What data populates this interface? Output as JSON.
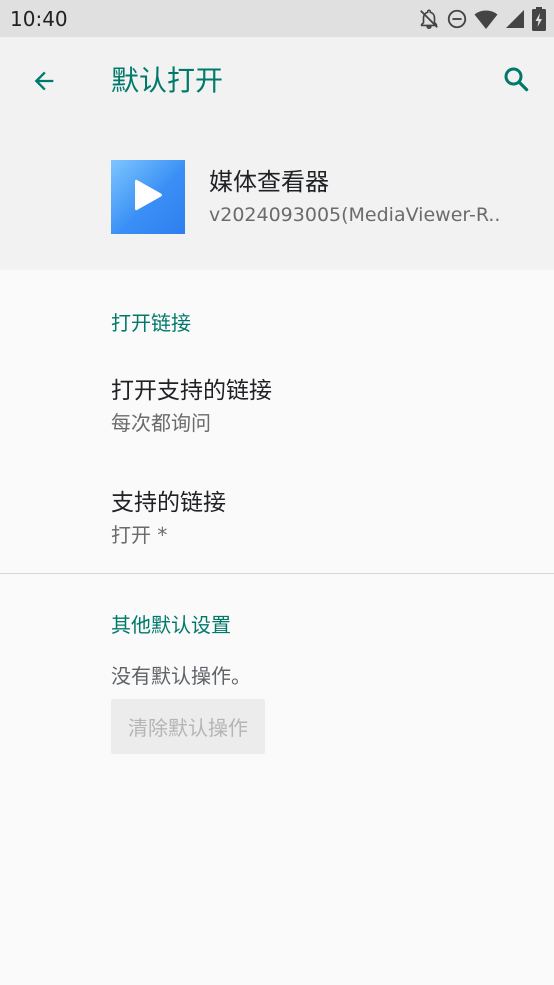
{
  "status_bar": {
    "time": "10:40",
    "icons": [
      "notifications-off-icon",
      "do-not-disturb-icon",
      "wifi-icon",
      "signal-icon",
      "battery-charging-icon"
    ]
  },
  "header": {
    "back_icon": "arrow-back-icon",
    "title": "默认打开",
    "search_icon": "search-icon"
  },
  "app": {
    "icon": "media-play-icon",
    "name": "媒体查看器",
    "version": "v2024093005(MediaViewer-R.."
  },
  "open_links": {
    "section_title": "打开链接",
    "items": [
      {
        "title": "打开支持的链接",
        "summary": "每次都询问"
      },
      {
        "title": "支持的链接",
        "summary": "打开 *"
      }
    ]
  },
  "other_defaults": {
    "section_title": "其他默认设置",
    "message": "没有默认操作。",
    "clear_button": "清除默认操作"
  },
  "colors": {
    "accent": "#00796b",
    "status_bar": "#e0e0e0",
    "header_bg": "#f2f2f2",
    "page_bg": "#fafafa"
  }
}
